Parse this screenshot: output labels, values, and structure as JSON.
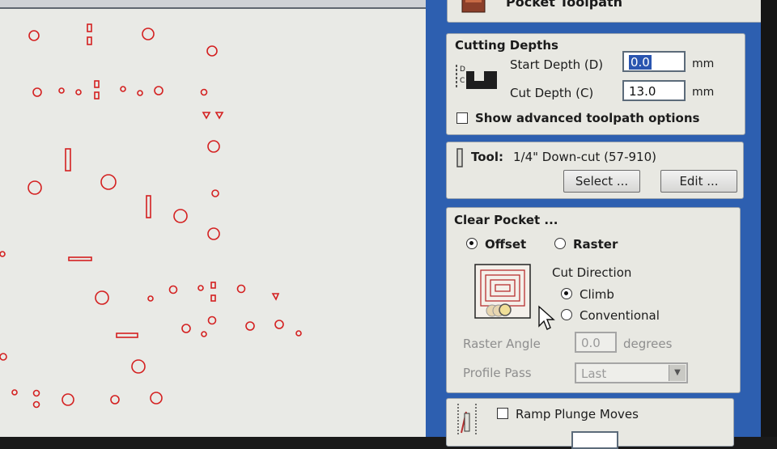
{
  "header": {
    "title": "Pocket Toolpath"
  },
  "cutting_depths": {
    "title": "Cutting Depths",
    "start_label": "Start Depth (D)",
    "start_value": "0.0",
    "start_unit": "mm",
    "cut_label": "Cut Depth (C)",
    "cut_value": "13.0",
    "cut_unit": "mm",
    "advanced_label": "Show advanced toolpath options",
    "advanced_checked": false
  },
  "tool": {
    "label": "Tool:",
    "name": "1/4\" Down-cut (57-910)",
    "select_label": "Select ...",
    "edit_label": "Edit ..."
  },
  "clear_pocket": {
    "title": "Clear Pocket ...",
    "offset_label": "Offset",
    "raster_label": "Raster",
    "selected": "Offset",
    "direction_title": "Cut Direction",
    "climb_label": "Climb",
    "conventional_label": "Conventional",
    "direction_selected": "Climb",
    "raster_angle_label": "Raster Angle",
    "raster_angle_value": "0.0",
    "raster_angle_unit": "degrees",
    "profile_pass_label": "Profile Pass",
    "profile_pass_value": "Last"
  },
  "ramp": {
    "label": "Ramp Plunge Moves",
    "checked": false
  },
  "colors": {
    "panel": "#2d5fb0",
    "canvas": "#e9eae6",
    "vector": "#d42020"
  },
  "icons": [
    "toolpath-icon",
    "depth-diagram-icon",
    "tool-bit-icon",
    "offset-pattern-icon",
    "ramp-diagram-icon",
    "mouse-cursor-icon",
    "dropdown-arrow-icon"
  ]
}
